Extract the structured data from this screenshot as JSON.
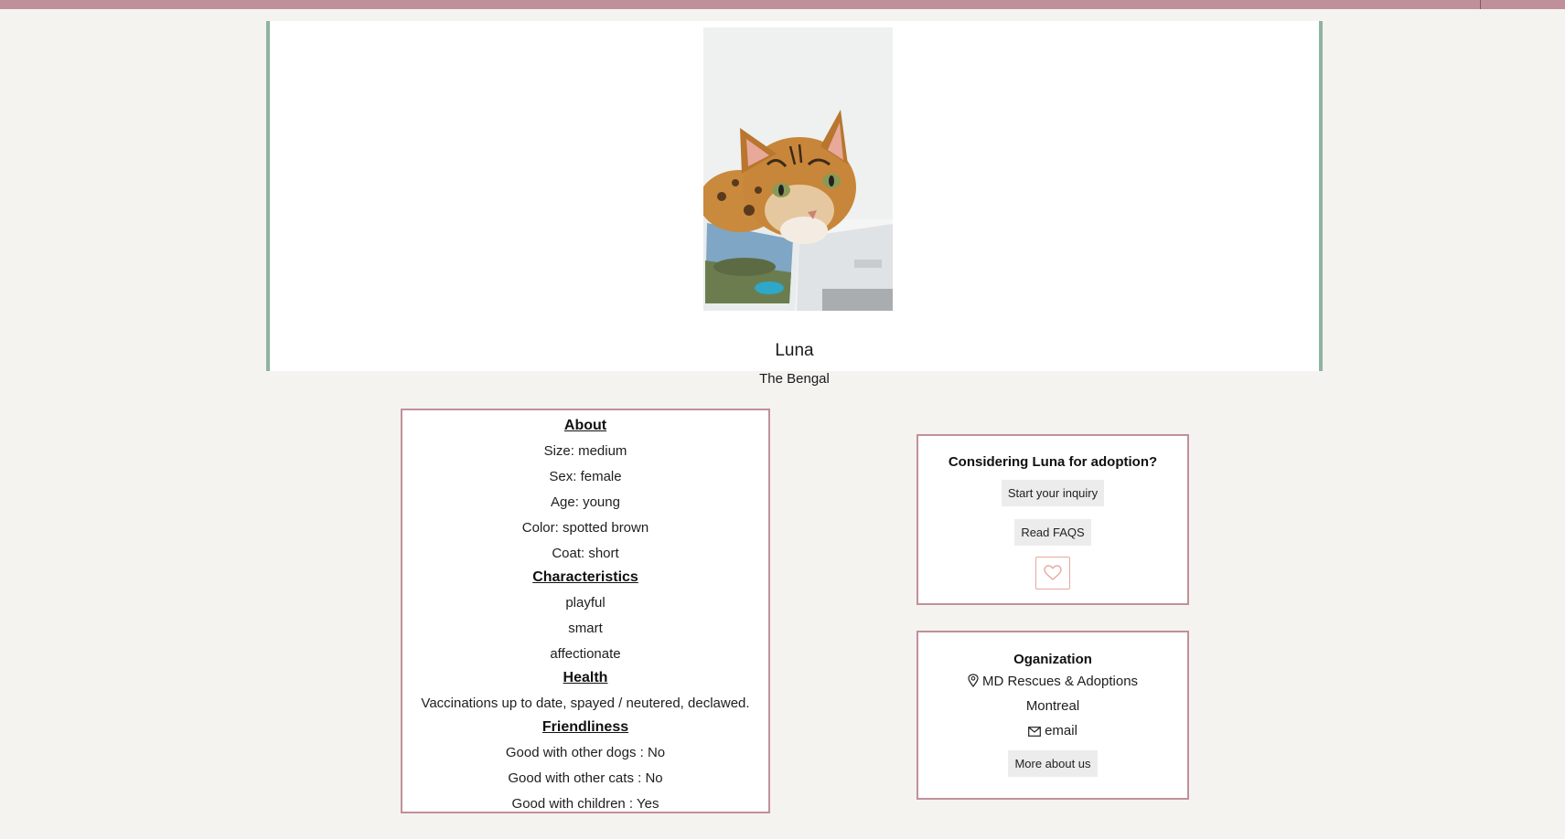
{
  "pet": {
    "name": "Luna",
    "breed": "The Bengal",
    "photo_icon": "bengal-cat-photo"
  },
  "about": {
    "heading": "About",
    "size": "Size: medium",
    "sex": "Sex: female",
    "age": "Age: young",
    "color": "Color: spotted brown",
    "coat": "Coat: short"
  },
  "characteristics": {
    "heading": "Characteristics",
    "items": [
      "playful",
      "smart",
      "affectionate"
    ]
  },
  "health": {
    "heading": "Health",
    "text": "Vaccinations up to date, spayed / neutered, declawed."
  },
  "friendliness": {
    "heading": "Friendliness",
    "dogs": "Good with other dogs : No",
    "cats": "Good with other cats : No",
    "children": "Good with children : Yes"
  },
  "adoption": {
    "title": "Considering Luna for adoption?",
    "inquiry_label": "Start your inquiry",
    "faq_label": "Read FAQS",
    "favorite_icon": "heart-icon"
  },
  "organization": {
    "title": "Oganization",
    "name": "MD Rescues & Adoptions",
    "city": "Montreal",
    "email_label": "email",
    "more_label": "More about us"
  },
  "colors": {
    "top_bar": "#c0909a",
    "hero_border": "#8fb3a2",
    "panel_border": "#c0909a",
    "heart": "#e6a99c",
    "background": "#f5f3f0"
  }
}
